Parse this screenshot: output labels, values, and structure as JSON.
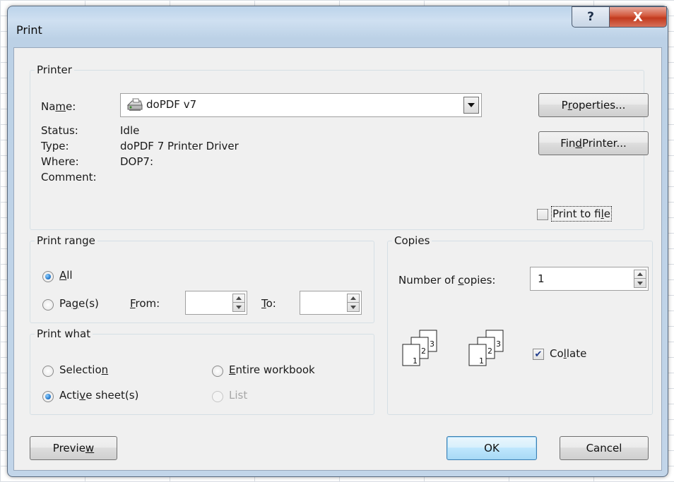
{
  "dialog": {
    "title": "Print",
    "help_glyph": "?",
    "close_glyph": "X"
  },
  "printer": {
    "legend": "Printer",
    "name_label": {
      "pre": "Na",
      "key": "m",
      "post": "e:"
    },
    "name_value": "doPDF v7",
    "printer_icon": "printer-icon",
    "status_label": "Status:",
    "status_value": "Idle",
    "type_label": "Type:",
    "type_value": "doPDF 7 Printer Driver",
    "where_label": "Where:",
    "where_value": "DOP7:",
    "comment_label": "Comment:",
    "properties_button": {
      "pre": "P",
      "key": "r",
      "post": "operties..."
    },
    "find_printer_button": {
      "pre": "Fin",
      "key": "d",
      "post": " Printer..."
    },
    "print_to_file": {
      "pre": "Print to fi",
      "key": "l",
      "post": "e",
      "checked": false
    }
  },
  "print_range": {
    "legend": "Print range",
    "all": {
      "pre": "",
      "key": "A",
      "post": "ll",
      "selected": true
    },
    "pages": {
      "pre": "Pa",
      "key": "g",
      "post": "e(s)",
      "selected": false
    },
    "from_label": {
      "pre": "",
      "key": "F",
      "post": "rom:"
    },
    "from_value": "",
    "to_label": {
      "pre": "",
      "key": "T",
      "post": "o:"
    },
    "to_value": ""
  },
  "print_what": {
    "legend": "Print what",
    "selection": {
      "pre": "Selectio",
      "key": "n",
      "post": "",
      "selected": false
    },
    "active_sheets": {
      "pre": "Acti",
      "key": "v",
      "post": "e sheet(s)",
      "selected": true
    },
    "entire_workbook": {
      "pre": "",
      "key": "E",
      "post": "ntire workbook",
      "selected": false
    },
    "list": {
      "label": "List",
      "enabled": false
    }
  },
  "copies": {
    "legend": "Copies",
    "number_label": {
      "pre": "Number of ",
      "key": "c",
      "post": "opies:"
    },
    "number_value": "1",
    "collate": {
      "pre": "Co",
      "key": "l",
      "post": "late",
      "checked": true
    },
    "collate_icon_pages": [
      "1",
      "2",
      "3"
    ]
  },
  "footer": {
    "preview_button": {
      "pre": "Previe",
      "key": "w",
      "post": ""
    },
    "ok_button": "OK",
    "cancel_button": "Cancel"
  },
  "colors": {
    "titlebar": "#c2d5e9",
    "close_red": "#c23a1e",
    "radio_blue": "#1c6fc4",
    "check_blue": "#1f3b8c"
  }
}
